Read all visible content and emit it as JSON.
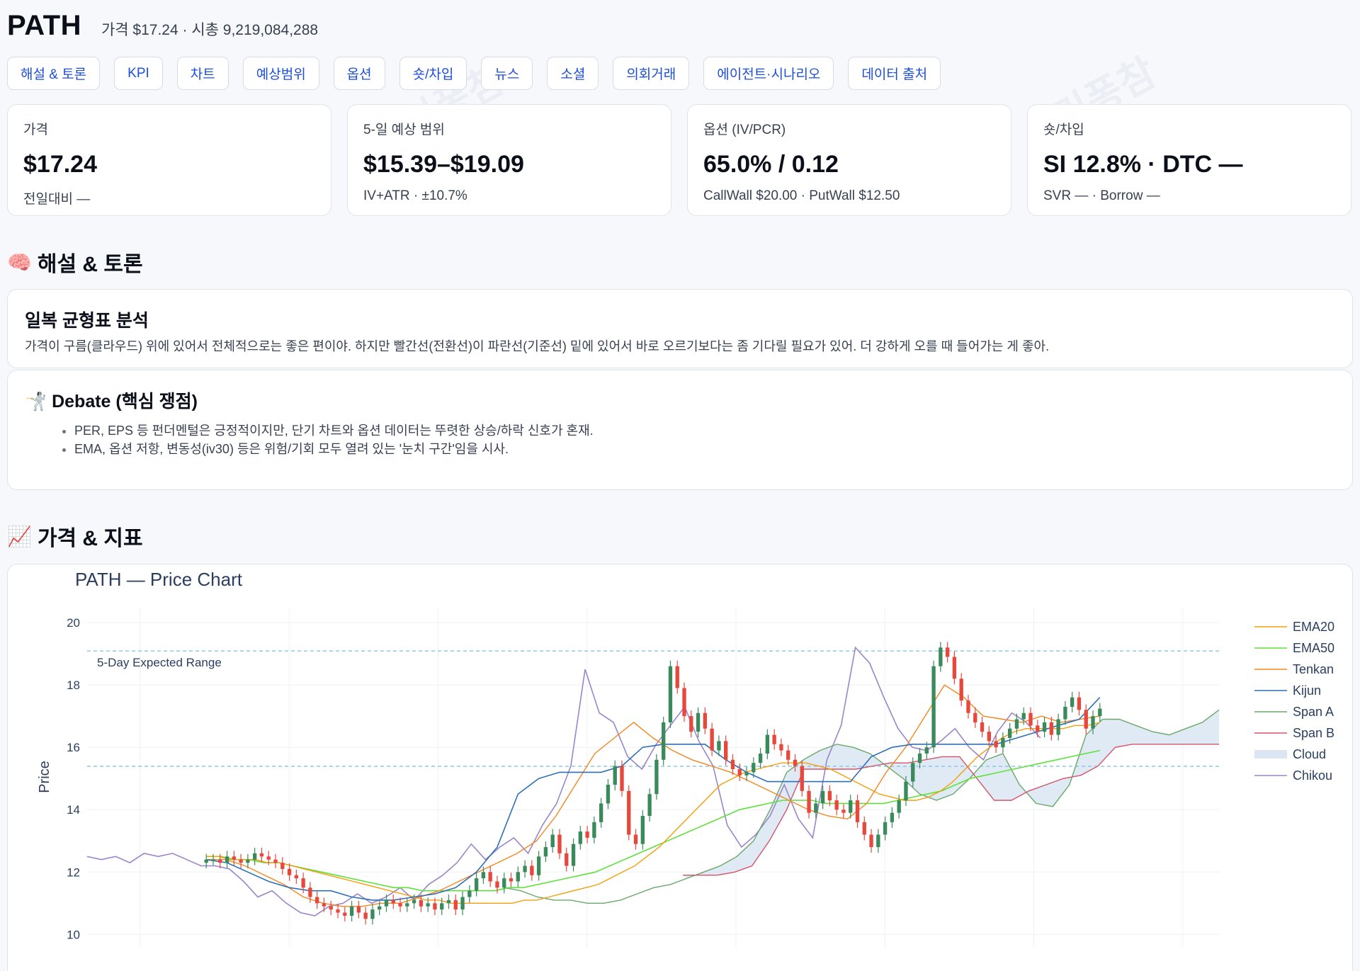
{
  "header": {
    "ticker": "PATH",
    "subtitle": "가격 $17.24 · 시총 9,219,084,288"
  },
  "tabs": [
    "해설 & 토론",
    "KPI",
    "차트",
    "예상범위",
    "옵션",
    "숏/차입",
    "뉴스",
    "소셜",
    "의회거래",
    "에이전트·시나리오",
    "데이터 출처"
  ],
  "kpis": [
    {
      "label": "가격",
      "value": "$17.24",
      "sub": "전일대비 —"
    },
    {
      "label": "5-일 예상 범위",
      "value": "$15.39–$19.09",
      "sub": "IV+ATR · ±10.7%"
    },
    {
      "label": "옵션 (IV/PCR)",
      "value": "65.0% / 0.12",
      "sub": "CallWall $20.00 · PutWall $12.50"
    },
    {
      "label": "숏/차입",
      "value": "SI 12.8% · DTC —",
      "sub": "SVR — · Borrow —"
    }
  ],
  "sections": {
    "commentary": {
      "emoji": "🧠",
      "title": "해설 & 토론"
    },
    "price": {
      "emoji": "📈",
      "title": "가격 & 지표"
    }
  },
  "analysis": {
    "title": "일복 균형표 분석",
    "text": "가격이 구름(클라우드) 위에 있어서 전체적으로는 좋은 편이야. 하지만 빨간선(전환선)이 파란선(기준선) 밑에 있어서 바로 오르기보다는 좀 기다릴 필요가 있어. 더 강하게 오를 때 들어가는 게 좋아."
  },
  "debate": {
    "emoji": "🤺",
    "title": "Debate (핵심 쟁점)",
    "points": [
      "PER, EPS 등 펀더멘털은 긍정적이지만, 단기 차트와 옵션 데이터는 뚜렷한 상승/하락 신호가 혼재.",
      "EMA, 옵션 저항, 변동성(iv30) 등은 위험/기회 모두 열려 있는 '눈치 구간'임을 시사."
    ]
  },
  "watermark": "리퐁참",
  "chart_data": {
    "type": "line",
    "title": "PATH — Price Chart",
    "ylabel": "Price",
    "ylim": [
      9.6,
      20.5
    ],
    "yticks": [
      10,
      12,
      14,
      16,
      18,
      20
    ],
    "x_range": [
      0,
      190
    ],
    "grid": true,
    "legend_position": "right",
    "annotation": "5-Day Expected Range",
    "expected_range": [
      15.39,
      19.09
    ],
    "colors": {
      "ema20": "#f59e0b",
      "ema50": "#5ee13a",
      "tenkan": "#f5871f",
      "kijun": "#2f6fb8",
      "spanA": "#6aa86a",
      "spanB": "#d2556a",
      "cloud": "#dbe6f2",
      "chikou": "#9b85c9",
      "up": "#3a8a5c",
      "down": "#e8483c",
      "range": "#8ec8e8"
    },
    "legend": [
      "EMA20",
      "EMA50",
      "Tenkan",
      "Kijun",
      "Span A",
      "Span B",
      "Cloud",
      "Chikou"
    ],
    "candles_close": [
      12.4,
      12.4,
      12.3,
      12.5,
      12.4,
      12.3,
      12.4,
      12.6,
      12.5,
      12.4,
      12.3,
      12.1,
      11.9,
      11.8,
      11.5,
      11.2,
      11.0,
      10.9,
      10.8,
      10.7,
      10.6,
      10.9,
      10.7,
      10.5,
      10.8,
      10.9,
      11.1,
      11.0,
      10.9,
      11.0,
      11.1,
      10.9,
      11.0,
      10.8,
      11.0,
      11.1,
      10.8,
      11.2,
      11.4,
      11.8,
      12.0,
      11.7,
      11.5,
      11.8,
      11.7,
      12.0,
      12.2,
      11.9,
      12.5,
      12.8,
      13.2,
      12.6,
      12.2,
      12.9,
      13.3,
      13.1,
      13.6,
      14.2,
      14.8,
      15.4,
      14.6,
      13.2,
      12.9,
      13.8,
      14.5,
      15.6,
      16.8,
      18.6,
      17.9,
      17.0,
      16.5,
      17.1,
      16.6,
      15.9,
      16.2,
      15.6,
      15.3,
      15.1,
      15.2,
      15.5,
      15.8,
      16.4,
      16.1,
      15.9,
      15.6,
      15.4,
      14.6,
      13.9,
      14.2,
      14.6,
      14.3,
      14.0,
      13.9,
      14.3,
      13.6,
      13.2,
      12.8,
      13.2,
      13.6,
      13.9,
      14.3,
      14.9,
      15.5,
      15.8,
      16.0,
      18.6,
      19.2,
      18.9,
      18.2,
      17.5,
      17.1,
      16.8,
      16.5,
      16.2,
      16.0,
      16.3,
      16.6,
      16.9,
      17.1,
      16.7,
      16.5,
      16.8,
      16.4,
      16.9,
      17.3,
      17.6,
      17.2,
      16.6,
      17.0,
      17.24
    ],
    "ema20": [
      12.5,
      12.5,
      12.4,
      12.4,
      12.4,
      12.3,
      12.3,
      12.2,
      12.1,
      12.0,
      11.9,
      11.8,
      11.7,
      11.6,
      11.5,
      11.4,
      11.3,
      11.2,
      11.1,
      11.1,
      11.0,
      11.0,
      11.0,
      11.0,
      11.0,
      11.0,
      11.1,
      11.1,
      11.2,
      11.3,
      11.4,
      11.5,
      11.6,
      11.8,
      12.0,
      12.2,
      12.5,
      12.8,
      13.2,
      13.6,
      14.0,
      14.4,
      14.8,
      15.0,
      15.2,
      15.3,
      15.4,
      15.5,
      15.5,
      15.5,
      15.4,
      15.3,
      15.1,
      14.9,
      14.7,
      14.5,
      14.4,
      14.3,
      14.3,
      14.4,
      14.6,
      14.9,
      15.3,
      15.7,
      16.0,
      16.3,
      16.5,
      16.6,
      16.6,
      16.6,
      16.6,
      16.7,
      16.7,
      16.8
    ],
    "ema50": [
      12.5,
      12.5,
      12.4,
      12.4,
      12.3,
      12.3,
      12.2,
      12.1,
      12.0,
      11.9,
      11.8,
      11.7,
      11.6,
      11.5,
      11.5,
      11.4,
      11.4,
      11.4,
      11.4,
      11.4,
      11.4,
      11.5,
      11.5,
      11.6,
      11.7,
      11.8,
      11.9,
      12.0,
      12.2,
      12.4,
      12.6,
      12.8,
      13.0,
      13.2,
      13.4,
      13.6,
      13.8,
      14.0,
      14.1,
      14.2,
      14.3,
      14.3,
      14.3,
      14.2,
      14.2,
      14.2,
      14.2,
      14.2,
      14.3,
      14.4,
      14.5,
      14.6,
      14.8,
      15.0,
      15.1,
      15.2,
      15.3,
      15.4,
      15.5,
      15.6,
      15.7,
      15.8,
      15.9
    ],
    "tenkan": [
      12.4,
      12.4,
      12.2,
      11.9,
      11.6,
      11.2,
      11.0,
      10.9,
      10.9,
      11.0,
      11.0,
      11.2,
      11.4,
      11.7,
      12.0,
      12.3,
      12.6,
      13.0,
      13.8,
      14.8,
      15.8,
      16.3,
      16.8,
      16.3,
      15.9,
      15.6,
      15.4,
      15.2,
      14.9,
      14.6,
      14.3,
      14.0,
      13.8,
      13.7,
      14.2,
      15.2,
      16.0,
      17.0,
      18.0,
      17.6,
      17.0,
      16.9,
      16.8,
      17.0,
      16.8,
      16.9,
      17.0
    ],
    "kijun": [
      12.4,
      12.3,
      12.0,
      11.7,
      11.5,
      11.4,
      11.4,
      11.2,
      11.1,
      11.1,
      11.2,
      11.3,
      11.5,
      12.0,
      12.8,
      14.5,
      15.0,
      15.2,
      15.2,
      15.2,
      15.4,
      16.0,
      16.1,
      16.1,
      16.1,
      15.6,
      15.2,
      14.9,
      14.9,
      14.9,
      14.9,
      14.9,
      15.7,
      16.0,
      16.1,
      16.1,
      16.1,
      16.1,
      16.1,
      16.3,
      16.5,
      16.7,
      16.9,
      17.6
    ],
    "spanA": [
      11.5,
      11.4,
      11.2,
      11.1,
      11.1,
      11.0,
      11.0,
      11.1,
      11.3,
      11.5,
      11.6,
      11.8,
      12.0,
      12.2,
      12.5,
      13.0,
      14.0,
      15.2,
      15.6,
      15.9,
      16.1,
      16.0,
      15.8,
      15.4,
      15.0,
      14.5,
      14.3,
      14.5,
      15.0,
      15.6,
      15.8,
      14.8,
      14.2,
      14.1,
      14.8,
      16.4,
      16.9,
      16.9,
      16.7,
      16.5,
      16.4,
      16.6,
      16.8,
      17.2
    ],
    "spanB": [
      11.9,
      11.9,
      11.9,
      12.0,
      12.2,
      13.0,
      14.0,
      15.3,
      15.3,
      15.3,
      15.3,
      15.4,
      15.5,
      15.5,
      15.6,
      15.7,
      15.7,
      15.0,
      14.3,
      14.3,
      14.6,
      14.8,
      15.0,
      15.1,
      15.4,
      16.0,
      16.1,
      16.1,
      16.1,
      16.1,
      16.1,
      16.1
    ],
    "chikou": [
      12.5,
      12.4,
      12.5,
      12.3,
      12.6,
      12.5,
      12.6,
      12.4,
      12.2,
      12.2,
      12.1,
      11.7,
      11.2,
      11.4,
      11.0,
      10.7,
      10.6,
      10.9,
      11.0,
      11.3,
      11.0,
      11.2,
      11.5,
      11.1,
      11.6,
      11.9,
      12.3,
      12.9,
      12.4,
      12.8,
      13.1,
      12.6,
      13.5,
      14.2,
      15.4,
      18.5,
      17.1,
      16.8,
      15.7,
      15.3,
      16.1,
      16.7,
      17.3,
      16.2,
      15.4,
      13.5,
      12.8,
      13.2,
      13.8,
      14.8,
      13.7,
      13.1,
      15.6,
      16.7,
      19.2,
      18.7,
      17.6,
      16.6,
      16.0,
      15.9,
      16.2,
      16.6,
      16.0,
      15.6,
      16.5,
      17.1,
      16.8,
      16.3
    ],
    "x": [
      0,
      190
    ]
  }
}
